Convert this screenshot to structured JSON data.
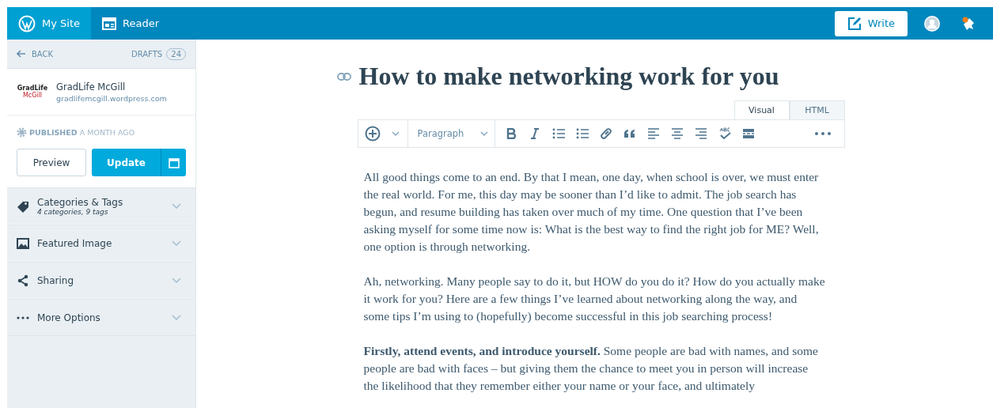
{
  "masterbar": {
    "items": [
      {
        "label": "My Site",
        "kind": "wp",
        "selected": true
      },
      {
        "label": "Reader",
        "kind": "reader",
        "selected": false
      }
    ],
    "write": "Write"
  },
  "sidebar": {
    "back": "BACK",
    "drafts": "DRAFTS",
    "drafts_count": "24",
    "site_name": "GradLife McGill",
    "site_url": "gradlifemcgill.wordpress.com",
    "logo_top": "GradLife",
    "logo_bottom": "McGill",
    "status_bold": "PUBLISHED",
    "status_rest": "A MONTH AGO",
    "preview": "Preview",
    "update": "Update",
    "sections": [
      {
        "label": "Categories & Tags",
        "sub": "4 categories, 9 tags",
        "kind": "tag"
      },
      {
        "label": "Featured Image",
        "kind": "image"
      },
      {
        "label": "Sharing",
        "kind": "share"
      },
      {
        "label": "More Options",
        "kind": "more"
      }
    ]
  },
  "editor": {
    "title": "How to make networking work for you",
    "tabs": [
      {
        "label": "Visual",
        "selected": true
      },
      {
        "label": "HTML",
        "selected": false
      }
    ],
    "format": "Paragraph",
    "tools": [
      {
        "kind": "bold"
      },
      {
        "kind": "italic"
      },
      {
        "kind": "ul"
      },
      {
        "kind": "ol"
      },
      {
        "kind": "link"
      },
      {
        "kind": "quote"
      },
      {
        "kind": "left"
      },
      {
        "kind": "center"
      },
      {
        "kind": "right"
      },
      {
        "kind": "spell"
      },
      {
        "kind": "more"
      }
    ],
    "paragraphs": [
      "All good things come to an end. By that I mean, one day, when school is over, we must enter the real world. For me, this day may be sooner than I’d like to admit. The job search has begun, and resume building has taken over much of my time. One question that I’ve been asking myself for some time now is: What is the best way to find the right job for ME? Well, one option is through networking.",
      "Ah, networking. Many people say to do it, but HOW do you do it? How do you actually make it work for you? Here are a few things I’ve learned about networking along the way, and some tips I’m using to (hopefully) become successful in this job searching process!",
      "**Firstly, attend events, and introduce yourself.** Some people are bad with names, and some people are bad with faces – but giving them the chance to meet you in person will increase the likelihood that they remember either your name or your face, and ultimately"
    ]
  }
}
